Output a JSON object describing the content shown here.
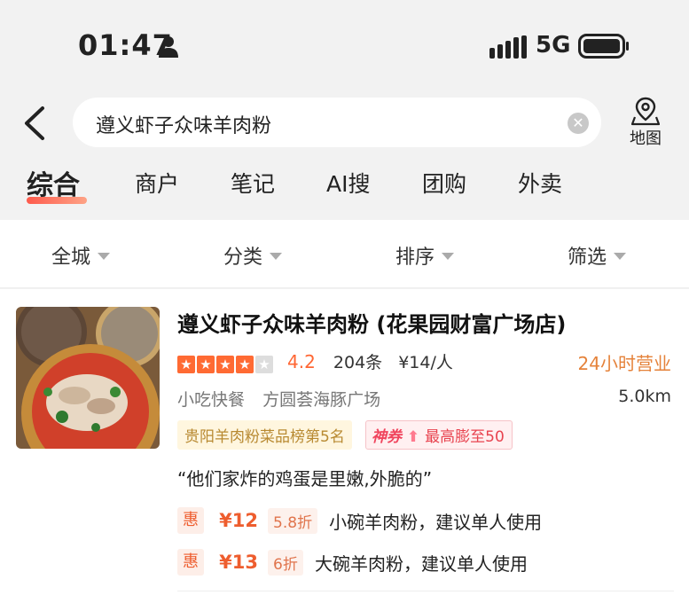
{
  "status_bar": {
    "time": "01:47",
    "network": "5G"
  },
  "search": {
    "query": "遵义虾子众味羊肉粉",
    "map_label": "地图"
  },
  "tabs": [
    {
      "label": "综合",
      "active": true
    },
    {
      "label": "商户",
      "active": false
    },
    {
      "label": "笔记",
      "active": false
    },
    {
      "label": "AI搜",
      "active": false
    },
    {
      "label": "团购",
      "active": false
    },
    {
      "label": "外卖",
      "active": false
    }
  ],
  "filters": [
    "全城",
    "分类",
    "排序",
    "筛选"
  ],
  "result": {
    "name": "遵义虾子众味羊肉粉 (花果园财富广场店)",
    "rating_stars": 4,
    "score": "4.2",
    "reviews": "204条",
    "avg_price": "¥14/人",
    "hours": "24小时营业",
    "category": "小吃快餐",
    "area": "方圆荟海豚广场",
    "distance": "5.0km",
    "rank_badge": "贵阳羊肉粉菜品榜第5名",
    "coupon_brand": "神券",
    "coupon_text": "最高膨至50",
    "quote": "“他们家炸的鸡蛋是里嫩,外脆的”",
    "deals": [
      {
        "tag": "惠",
        "price": "¥12",
        "discount": "5.8折",
        "desc": "小碗羊肉粉，建议单人使用"
      },
      {
        "tag": "惠",
        "price": "¥13",
        "discount": "6折",
        "desc": "大碗羊肉粉，建议单人使用"
      }
    ]
  },
  "colors": {
    "accent_orange": "#ff6633",
    "deal_orange": "#ee5d2e",
    "coupon_red": "#e8434f",
    "rank_gold": "#b88a32",
    "background": "#f2f2f2"
  }
}
